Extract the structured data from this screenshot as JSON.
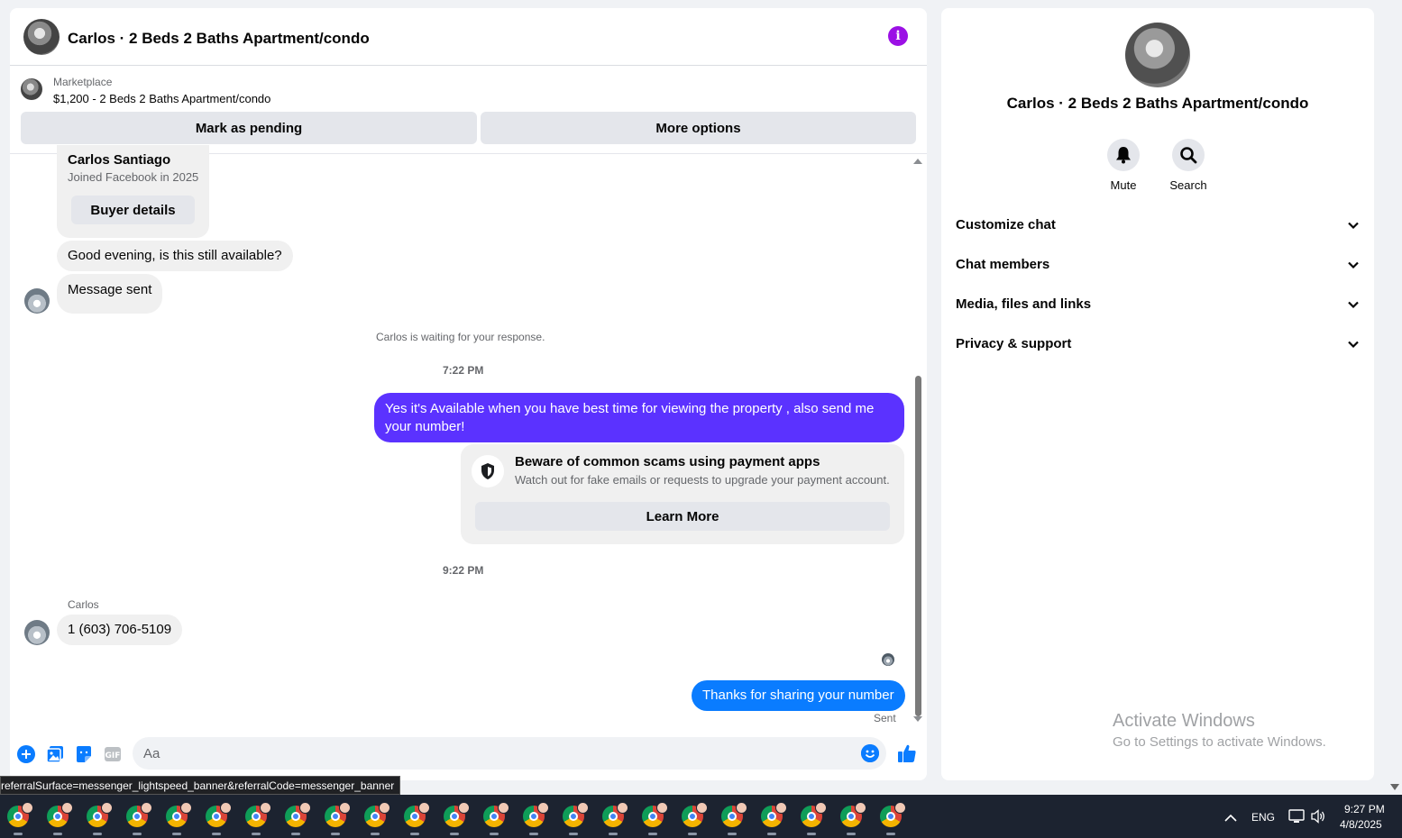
{
  "header": {
    "title": "Carlos · 2 Beds 2 Baths Apartment/condo",
    "info_icon": "info-icon"
  },
  "marketplace": {
    "label": "Marketplace",
    "listing": "$1,200 - 2 Beds 2 Baths Apartment/condo",
    "mark_pending": "Mark as pending",
    "more_options": "More options"
  },
  "profile_card": {
    "name": "Carlos Santiago",
    "joined": "Joined Facebook in 2025",
    "button": "Buyer details"
  },
  "messages": {
    "in1": "Good evening, is this still available?",
    "in2": "Message sent",
    "waiting": "Carlos is waiting for your response.",
    "time1": "7:22 PM",
    "out1": "Yes it's Available when you have best time for viewing the property , also send me your number!",
    "scam_title": "Beware of common scams using payment apps",
    "scam_text": "Watch out for fake emails or requests to upgrade your payment account.",
    "scam_button": "Learn More",
    "time2": "9:22 PM",
    "sender": "Carlos",
    "in3": "1 (603) 706-5109",
    "out2": "Thanks for sharing your number",
    "status": "Sent"
  },
  "composer": {
    "placeholder": "Aa"
  },
  "tooltip": "referralSurface=messenger_lightspeed_banner&referralCode=messenger_banner",
  "side": {
    "title": "Carlos · 2 Beds 2 Baths Apartment/condo",
    "mute": "Mute",
    "search": "Search",
    "sections": [
      "Customize chat",
      "Chat members",
      "Media, files and links",
      "Privacy & support"
    ]
  },
  "watermark": {
    "title": "Activate Windows",
    "subtitle": "Go to Settings to activate Windows."
  },
  "taskbar": {
    "lang": "ENG",
    "time": "9:27 PM",
    "date": "4/8/2025"
  },
  "colors": {
    "accent_purple": "#5b32ff",
    "accent_blue": "#0a7cff",
    "info_purple": "#9b10e5"
  }
}
